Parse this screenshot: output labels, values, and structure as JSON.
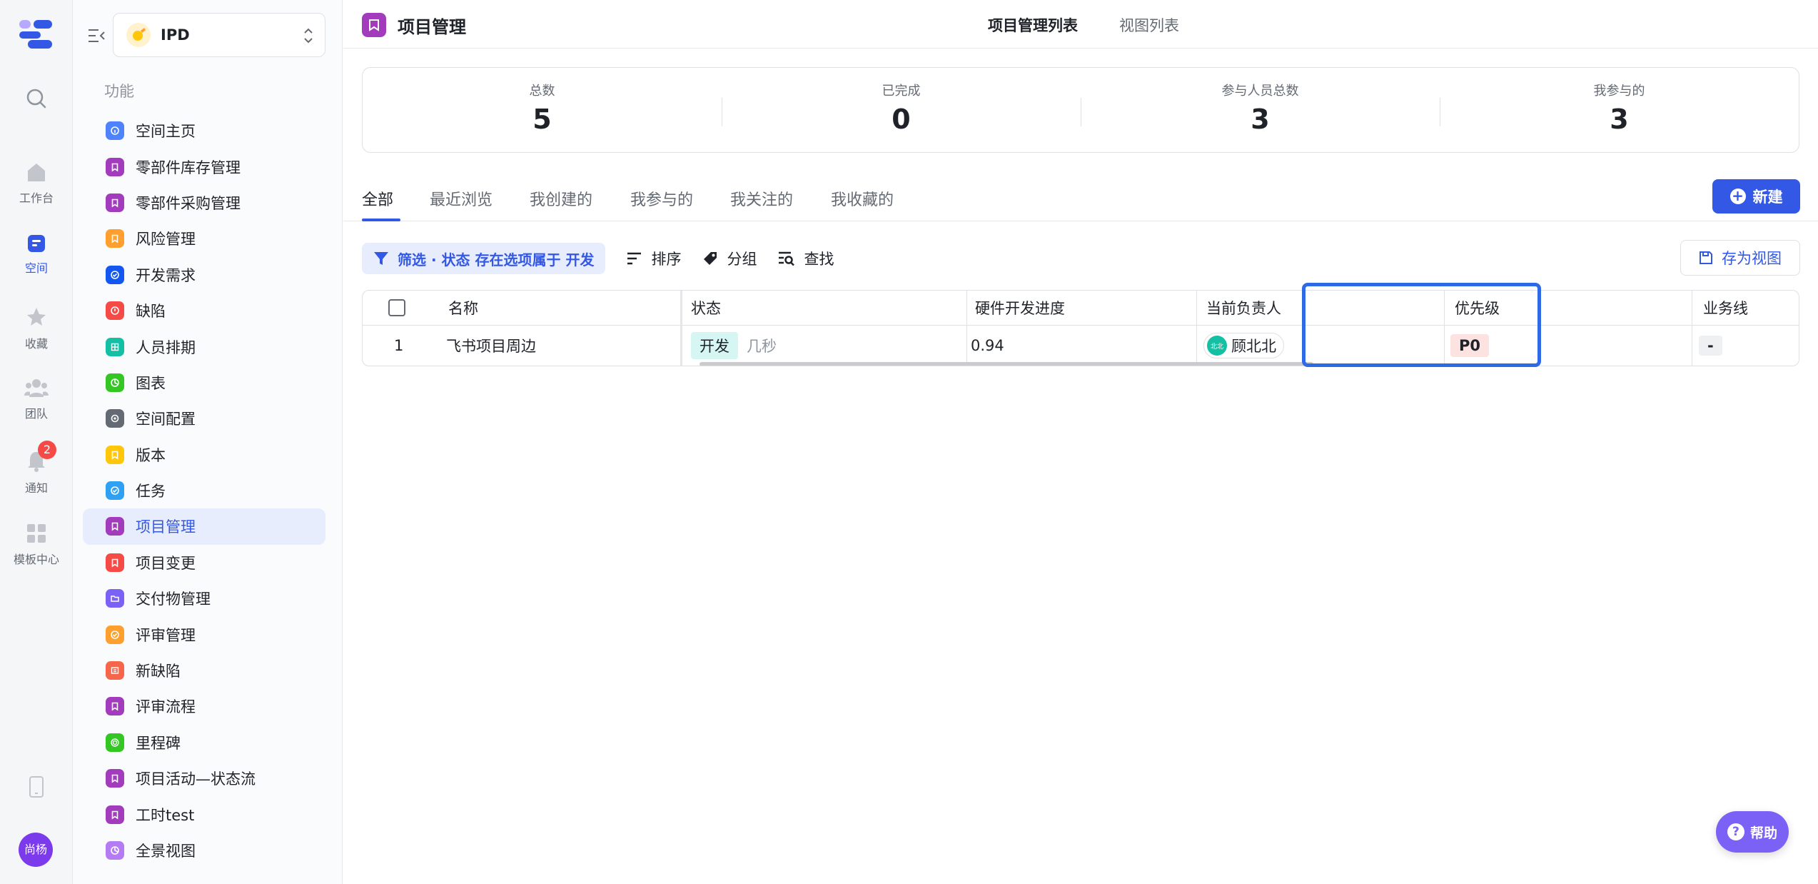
{
  "rail": {
    "items": [
      {
        "label": "",
        "icon": "search-icon"
      },
      {
        "label": "工作台",
        "icon": "home-icon"
      },
      {
        "label": "空间",
        "icon": "space-icon"
      },
      {
        "label": "收藏",
        "icon": "star-icon"
      },
      {
        "label": "团队",
        "icon": "team-icon"
      },
      {
        "label": "通知",
        "icon": "bell-icon"
      },
      {
        "label": "模板中心",
        "icon": "template-icon"
      }
    ],
    "notification_count": "2",
    "user_initials": "尚杨"
  },
  "sidebar": {
    "space_name": "IPD",
    "section_title": "功能",
    "items": [
      {
        "label": "空间主页",
        "color": "#4e83fd",
        "glyph": "i"
      },
      {
        "label": "零部件库存管理",
        "color": "#a33bbd",
        "glyph": "b"
      },
      {
        "label": "零部件采购管理",
        "color": "#a33bbd",
        "glyph": "b"
      },
      {
        "label": "风险管理",
        "color": "#ff9f2e",
        "glyph": "b"
      },
      {
        "label": "开发需求",
        "color": "#1456f0",
        "glyph": "c"
      },
      {
        "label": "缺陷",
        "color": "#f54a45",
        "glyph": "!"
      },
      {
        "label": "人员排期",
        "color": "#14c0a3",
        "glyph": "g"
      },
      {
        "label": "图表",
        "color": "#34c724",
        "glyph": "p"
      },
      {
        "label": "空间配置",
        "color": "#646a73",
        "glyph": "s"
      },
      {
        "label": "版本",
        "color": "#ffc60a",
        "glyph": "b"
      },
      {
        "label": "任务",
        "color": "#2ea1f5",
        "glyph": "c"
      },
      {
        "label": "项目管理",
        "color": "#a33bbd",
        "glyph": "b"
      },
      {
        "label": "项目变更",
        "color": "#f54a45",
        "glyph": "b"
      },
      {
        "label": "交付物管理",
        "color": "#7b61f5",
        "glyph": "f"
      },
      {
        "label": "评审管理",
        "color": "#ff9f2e",
        "glyph": "c"
      },
      {
        "label": "新缺陷",
        "color": "#f5664a",
        "glyph": "l"
      },
      {
        "label": "评审流程",
        "color": "#a33bbd",
        "glyph": "b"
      },
      {
        "label": "里程碑",
        "color": "#34c724",
        "glyph": "t"
      },
      {
        "label": "项目活动—状态流",
        "color": "#a33bbd",
        "glyph": "b"
      },
      {
        "label": "工时test",
        "color": "#a33bbd",
        "glyph": "b"
      },
      {
        "label": "全景视图",
        "color": "#b57bf5",
        "glyph": "p"
      }
    ],
    "active_index": 11
  },
  "topbar": {
    "title": "项目管理",
    "tabs": [
      "项目管理列表",
      "视图列表"
    ]
  },
  "stats": [
    {
      "label": "总数",
      "value": "5"
    },
    {
      "label": "已完成",
      "value": "0"
    },
    {
      "label": "参与人员总数",
      "value": "3"
    },
    {
      "label": "我参与的",
      "value": "3"
    }
  ],
  "tabs": [
    "全部",
    "最近浏览",
    "我创建的",
    "我参与的",
    "我关注的",
    "我收藏的"
  ],
  "new_button": "新建",
  "toolbar": {
    "filter": "筛选 · 状态 存在选项属于 开发",
    "sort": "排序",
    "group": "分组",
    "find": "查找",
    "save_view": "存为视图"
  },
  "table": {
    "headers": [
      "名称",
      "状态",
      "硬件开发进度",
      "当前负责人",
      "优先级",
      "业务线"
    ],
    "rows": [
      {
        "index": "1",
        "name": "飞书项目周边",
        "status": "开发",
        "status_time": "几秒",
        "hardware_progress": "0.94",
        "owner": "顾北北",
        "owner_avatar": "北北",
        "priority": "P0",
        "business_line": "-"
      }
    ]
  },
  "help_button": "帮助",
  "colors": {
    "accent": "#3358e6",
    "highlight": "#2f6ae6"
  }
}
